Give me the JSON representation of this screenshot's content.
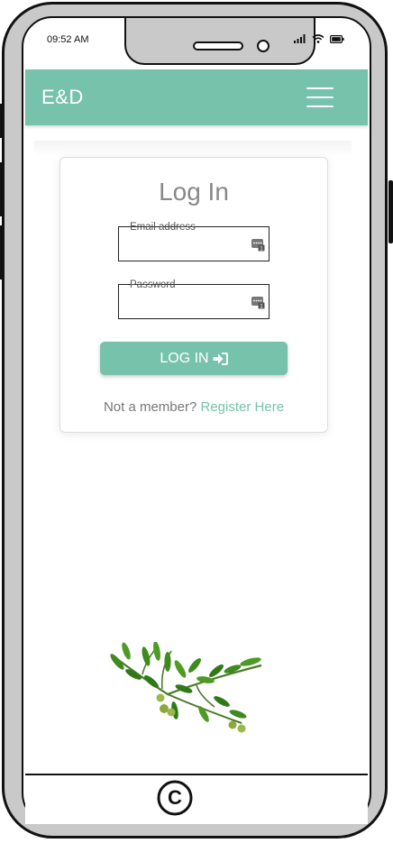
{
  "status_bar": {
    "time": "09:52 AM"
  },
  "navbar": {
    "brand": "E&D",
    "accent_color": "#76c2ab",
    "menu_icon": "hamburger-menu-icon"
  },
  "login": {
    "title": "Log In",
    "email_label": "Email address",
    "email_value": "",
    "password_label": "Password",
    "password_value": "",
    "field_icon": "password-manager-icon",
    "button_label": "LOG IN",
    "button_icon": "sign-in-icon",
    "member_prompt": "Not a member?",
    "register_label": "Register Here"
  },
  "footer": {
    "symbol": "©"
  },
  "decoration": {
    "image": "olive-branch-illustration"
  }
}
